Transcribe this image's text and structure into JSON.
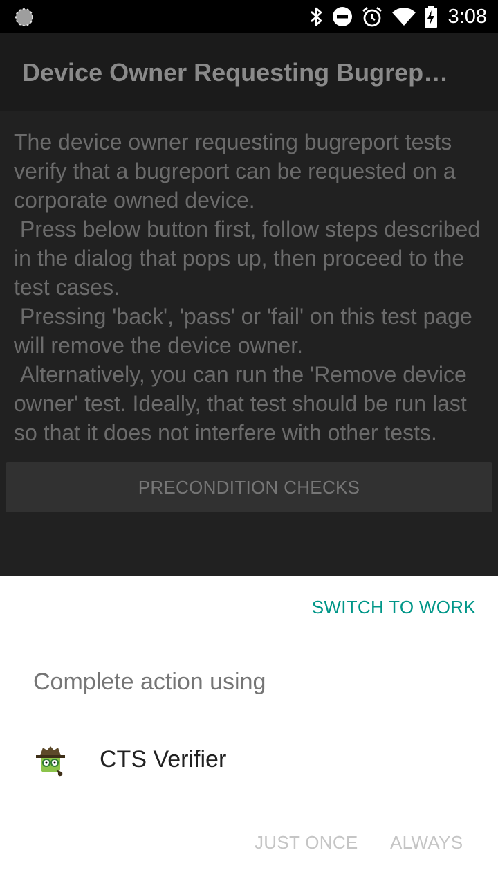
{
  "status_bar": {
    "time": "3:08",
    "icons": [
      "loading-icon",
      "bluetooth-icon",
      "do-not-disturb-icon",
      "alarm-icon",
      "wifi-icon",
      "battery-charging-icon"
    ]
  },
  "app": {
    "title": "Device Owner Requesting Bugrep…",
    "description": "The device owner requesting bugreport tests verify that a bugreport can be requested on a corporate owned device.\n Press below button first, follow steps described in the dialog that pops up, then proceed to the test cases.\n Pressing 'back', 'pass' or 'fail' on this test page will remove the device owner.\n Alternatively, you can run the 'Remove device owner' test. Ideally, that test should be run last so that it does not interfere with other tests.",
    "precondition_button": "PRECONDITION CHECKS"
  },
  "sheet": {
    "switch_label": "SWITCH TO WORK",
    "title": "Complete action using",
    "app_name": "CTS Verifier",
    "just_once_label": "JUST ONCE",
    "always_label": "ALWAYS",
    "accent_color": "#009688"
  }
}
